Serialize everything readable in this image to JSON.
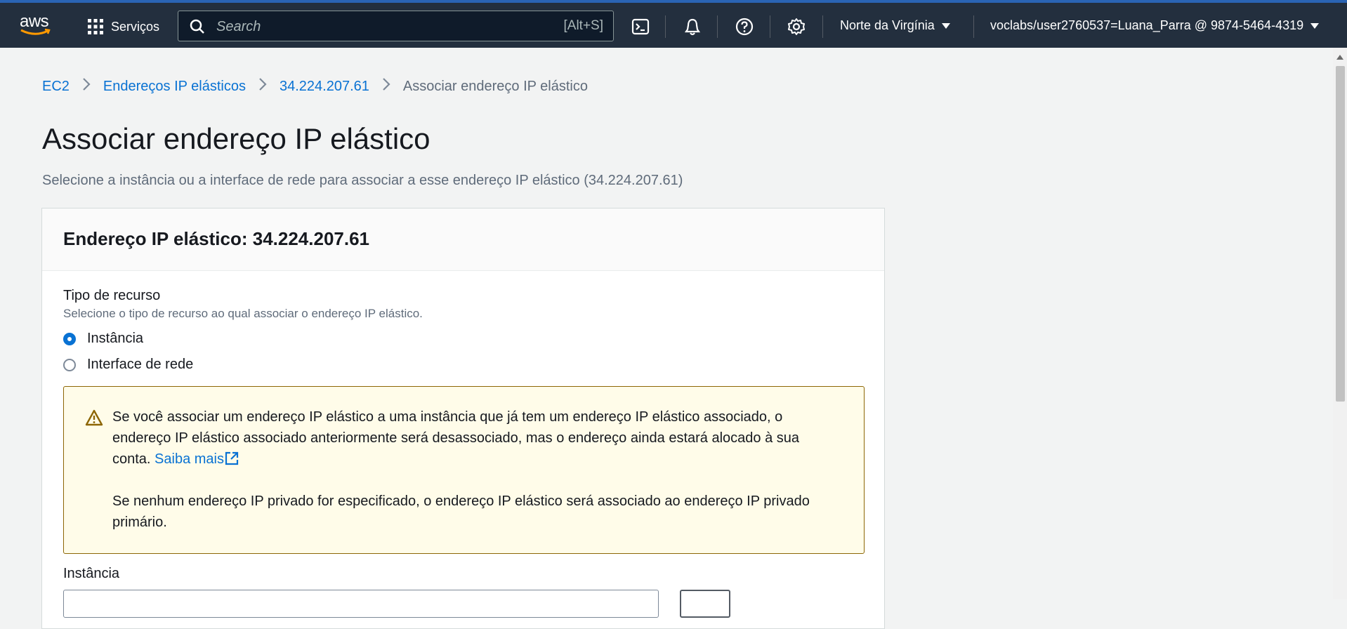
{
  "topnav": {
    "logo_text": "aws",
    "services_label": "Serviços",
    "search_placeholder": "Search",
    "search_shortcut": "[Alt+S]",
    "icons": [
      "cloudshell-icon",
      "bell-icon",
      "help-icon",
      "gear-icon"
    ],
    "region": "Norte da Virgínia",
    "account": "voclabs/user2760537=Luana_Parra @ 9874-5464-4319",
    "background": "#232f3e"
  },
  "breadcrumb": {
    "items": [
      "EC2",
      "Endereços IP elásticos",
      "34.224.207.61"
    ],
    "current": "Associar endereço IP elástico"
  },
  "page": {
    "title": "Associar endereço IP elástico",
    "subtitle": "Selecione a instância ou a interface de rede para associar a esse endereço IP elástico (34.224.207.61)"
  },
  "container": {
    "header": "Endereço IP elástico: 34.224.207.61",
    "resource_type": {
      "label": "Tipo de recurso",
      "description": "Selecione o tipo de recurso ao qual associar o endereço IP elástico.",
      "options": [
        {
          "label": "Instância",
          "selected": true
        },
        {
          "label": "Interface de rede",
          "selected": false
        }
      ]
    },
    "alert": {
      "text1": "Se você associar um endereço IP elástico a uma instância que já tem um endereço IP elástico associado, o endereço IP elástico associado anteriormente será desassociado, mas o endereço ainda estará alocado à sua conta.",
      "link": "Saiba mais",
      "text2": "Se nenhum endereço IP privado for especificado, o endereço IP elástico será associado ao endereço IP privado primário."
    },
    "instance_label": "Instância"
  },
  "colors": {
    "link": "#0972d3",
    "alert_bg": "#fffce9",
    "alert_border": "#8d6605"
  }
}
